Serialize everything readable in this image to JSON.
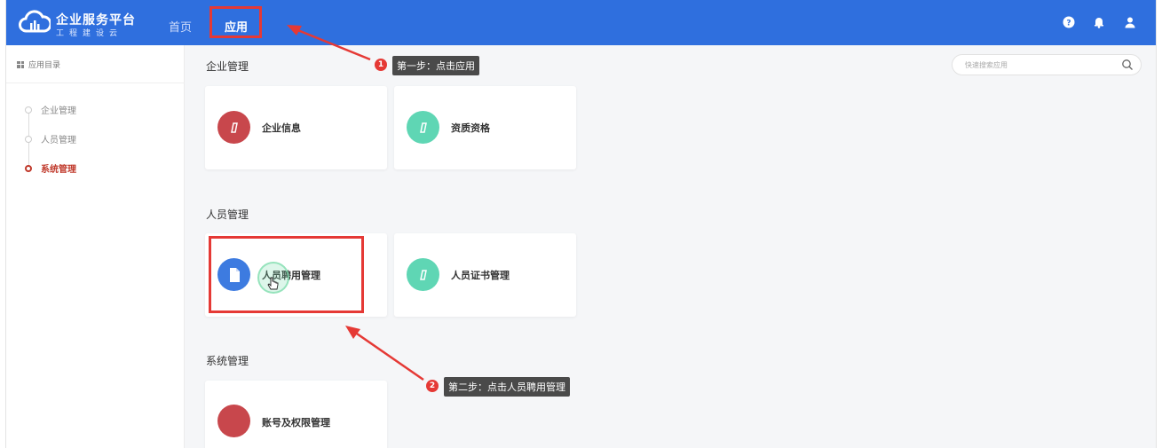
{
  "header": {
    "brand_title": "企业服务平台",
    "brand_subtitle": "工程建设云",
    "nav": [
      {
        "label": "首页"
      },
      {
        "label": "应用"
      }
    ],
    "accent_color": "#2f6fde",
    "icons": [
      "help-icon",
      "bell-icon",
      "user-icon"
    ]
  },
  "sidebar": {
    "heading": "应用目录",
    "items": [
      {
        "label": "企业管理",
        "active": false
      },
      {
        "label": "人员管理",
        "active": false
      },
      {
        "label": "系统管理",
        "active": true
      }
    ]
  },
  "search": {
    "placeholder": "快速搜索应用"
  },
  "sections": [
    {
      "title": "企业管理",
      "apps": [
        {
          "label": "企业信息",
          "icon": "pencil-icon",
          "color": "#c8474c"
        },
        {
          "label": "资质资格",
          "icon": "pencil-icon",
          "color": "#5fd6b4"
        }
      ]
    },
    {
      "title": "人员管理",
      "apps": [
        {
          "label": "人员聘用管理",
          "icon": "document-icon",
          "color": "#3d7be0"
        },
        {
          "label": "人员证书管理",
          "icon": "pencil-icon",
          "color": "#5fd6b4"
        }
      ]
    },
    {
      "title": "系统管理",
      "apps": [
        {
          "label": "账号及权限管理",
          "icon": "circle-icon",
          "color": "#c8474c"
        }
      ]
    }
  ],
  "annotations": [
    {
      "number": "1",
      "text": "第一步：点击应用"
    },
    {
      "number": "2",
      "text": "第二步：点击人员聘用管理"
    }
  ],
  "annotation_color": "#e53935"
}
